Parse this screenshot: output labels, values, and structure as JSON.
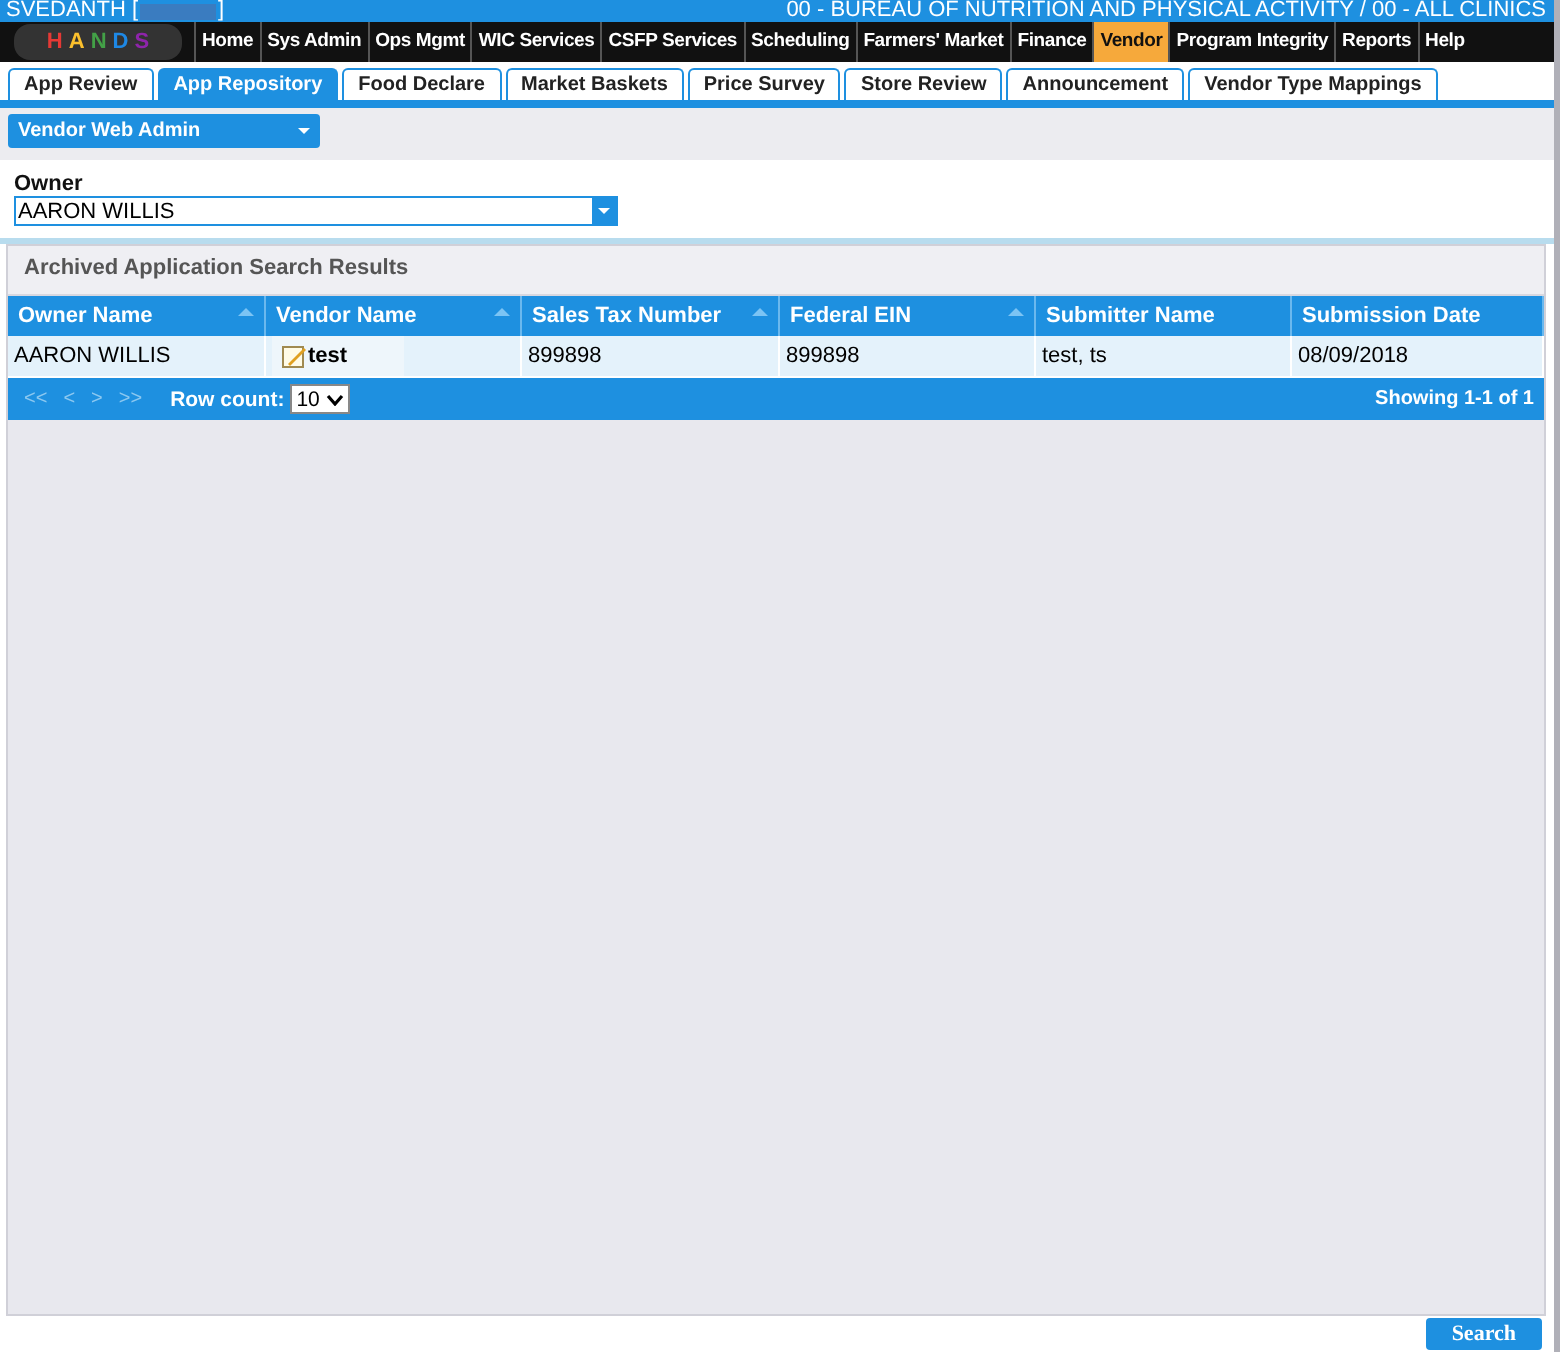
{
  "header": {
    "user": "SVEDANTH [",
    "user_close": "]",
    "location": "00 - BUREAU OF NUTRITION AND PHYSICAL ACTIVITY / 00 - ALL CLINICS"
  },
  "logo": {
    "letters": [
      "H",
      "A",
      "N",
      "D",
      "S"
    ]
  },
  "menu": [
    {
      "label": "Home",
      "selected": false
    },
    {
      "label": "Sys Admin",
      "selected": false
    },
    {
      "label": "Ops Mgmt",
      "selected": false
    },
    {
      "label": "WIC Services",
      "selected": false
    },
    {
      "label": "CSFP Services",
      "selected": false
    },
    {
      "label": "Scheduling",
      "selected": false
    },
    {
      "label": "Farmers' Market",
      "selected": false
    },
    {
      "label": "Finance",
      "selected": false
    },
    {
      "label": "Vendor",
      "selected": true
    },
    {
      "label": "Program Integrity",
      "selected": false
    },
    {
      "label": "Reports",
      "selected": false
    },
    {
      "label": "Help",
      "selected": false
    }
  ],
  "tabs": [
    {
      "label": "App Review",
      "selected": false
    },
    {
      "label": "App Repository",
      "selected": true
    },
    {
      "label": "Food Declare",
      "selected": false
    },
    {
      "label": "Market Baskets",
      "selected": false
    },
    {
      "label": "Price Survey",
      "selected": false
    },
    {
      "label": "Store Review",
      "selected": false
    },
    {
      "label": "Announcement",
      "selected": false
    },
    {
      "label": "Vendor Type Mappings",
      "selected": false
    }
  ],
  "section_dropdown": {
    "value": "Vendor Web Admin"
  },
  "owner": {
    "label": "Owner",
    "value": "AARON WILLIS"
  },
  "results": {
    "title": "Archived Application Search Results",
    "columns": [
      {
        "label": "Owner Name",
        "sortable": true
      },
      {
        "label": "Vendor Name",
        "sortable": true
      },
      {
        "label": "Sales Tax Number",
        "sortable": true
      },
      {
        "label": "Federal EIN",
        "sortable": true
      },
      {
        "label": "Submitter Name",
        "sortable": false
      },
      {
        "label": "Submission Date",
        "sortable": false
      }
    ],
    "rows": [
      {
        "cells": [
          "AARON WILLIS",
          "test",
          "899898",
          "899898",
          "test, ts",
          "08/09/2018"
        ]
      }
    ],
    "pager": {
      "first": "<<",
      "prev": "<",
      "next": ">",
      "last": ">>",
      "row_count_label": "Row count:",
      "row_count": "10",
      "showing": "Showing 1-1 of 1"
    }
  },
  "buttons": [
    {
      "label": "Search"
    }
  ]
}
